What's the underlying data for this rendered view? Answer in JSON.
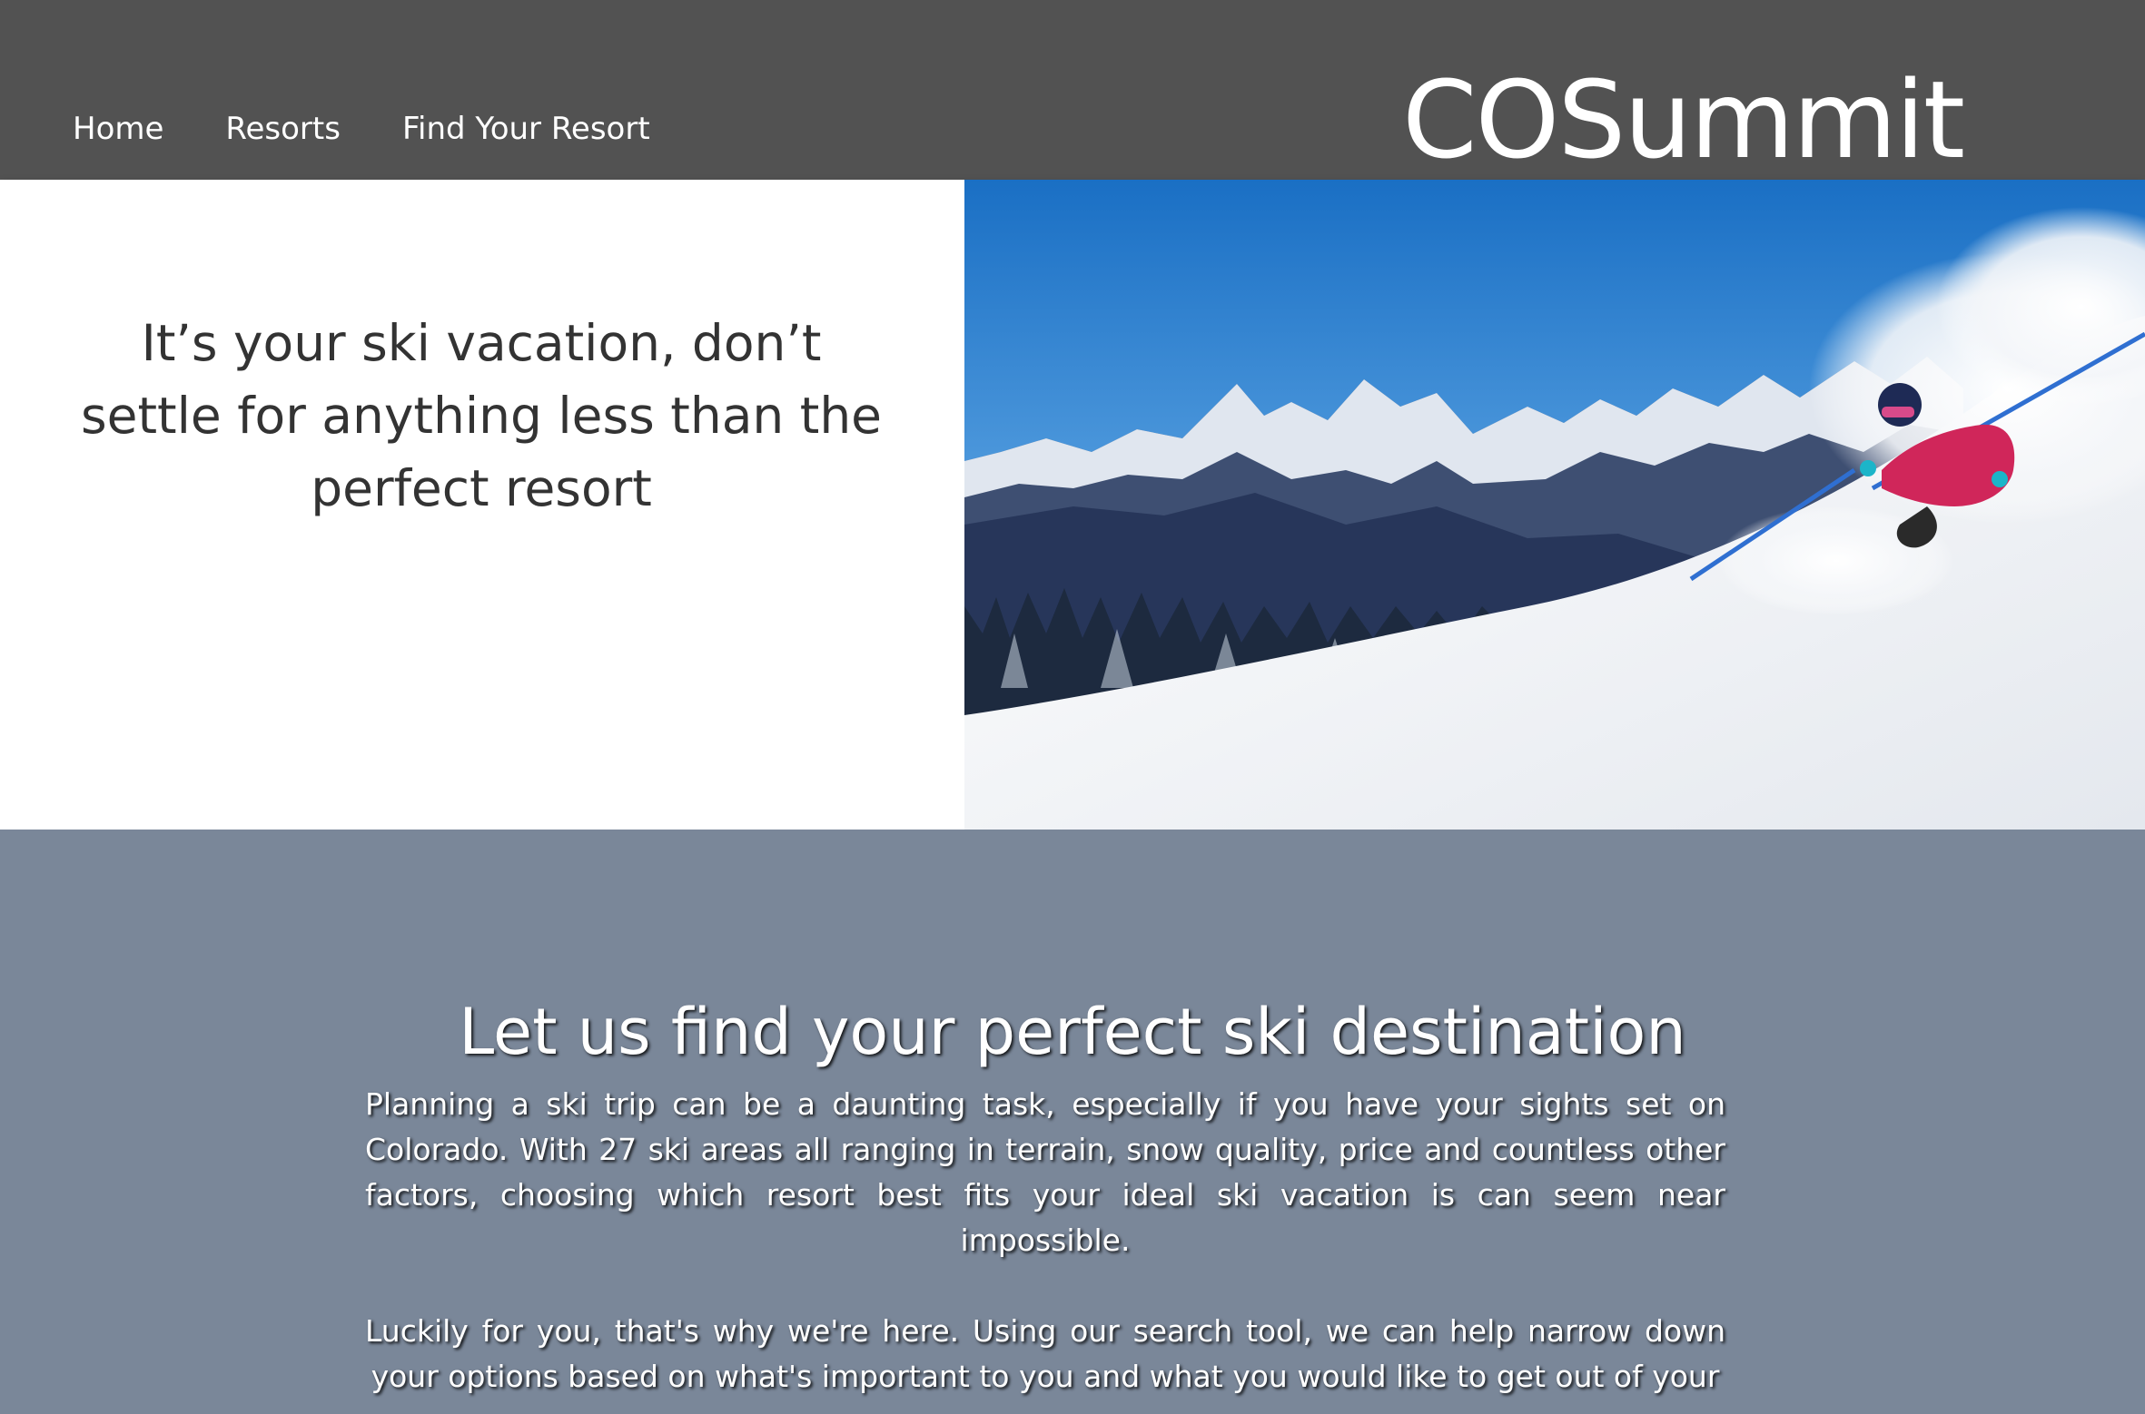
{
  "nav": {
    "links": [
      "Home",
      "Resorts",
      "Find Your Resort"
    ],
    "brand": "COSummit"
  },
  "hero": {
    "tagline": "It’s your ski vacation, don’t settle for anything less than the perfect resort",
    "image_icon": "skier-mountain-photo"
  },
  "info": {
    "title": "Let us find your perfect ski destination",
    "paragraphs": [
      "Planning a ski trip can be a daunting task, especially if you have your sights set on Colorado. With 27 ski areas all ranging in terrain, snow quality, price and countless other factors, choosing which resort best fits your ideal ski vacation is can seem near impossible.",
      "Luckily for you, that's why we're here. Using our search tool, we can help narrow down your options based on what's important to you and what you would like to get out of your"
    ]
  },
  "colors": {
    "navbar": "#525252",
    "info_background": "#7a8799",
    "hero_background": "#ffffff",
    "tagline_text": "#333333"
  }
}
